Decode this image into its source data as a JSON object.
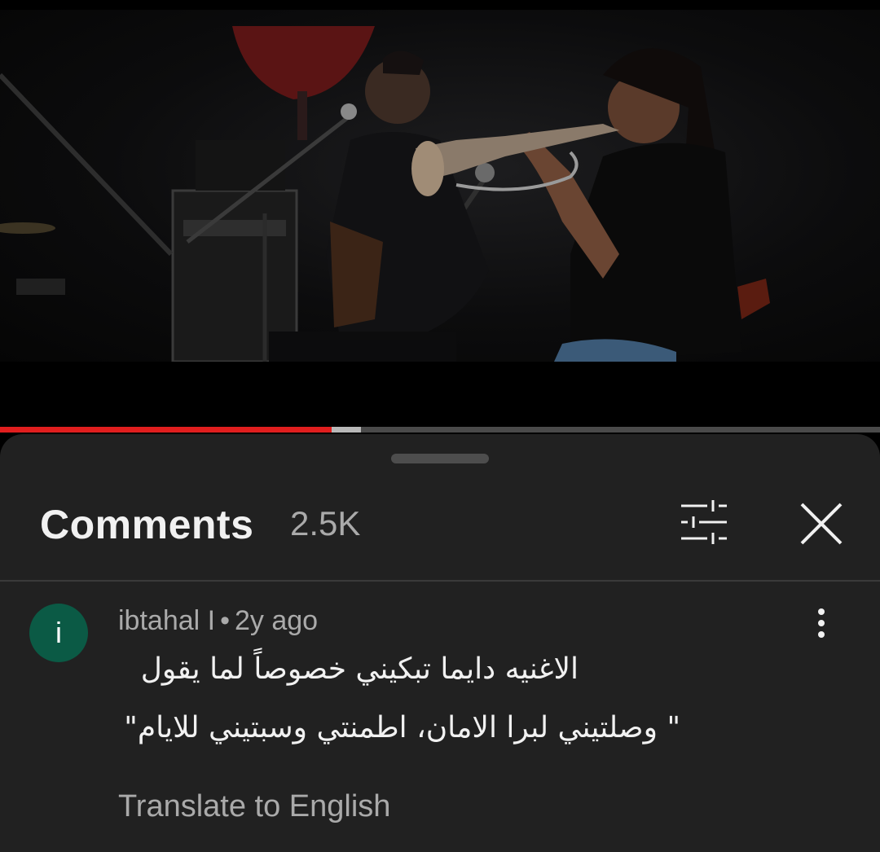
{
  "player": {
    "progress_played": 0.377,
    "progress_buffered": 0.41,
    "accent_color": "#e01e1e"
  },
  "comments_panel": {
    "title": "Comments",
    "count": "2.5K",
    "filter_icon": "sort-filter-icon",
    "close_icon": "close-icon"
  },
  "comments": [
    {
      "avatar_letter": "i",
      "avatar_color": "#0b5a45",
      "author": "ibtahal I",
      "separator": "•",
      "time": "2y ago",
      "text_lines": [
        "الاغنيه دايما تبكيني خصوصاً لما يقول",
        "\" وصلتيني لبرا الامان، اطمنتي وسبتيني للايام\""
      ],
      "translate_label": "Translate to English",
      "menu_icon": "more-vert-icon"
    }
  ]
}
